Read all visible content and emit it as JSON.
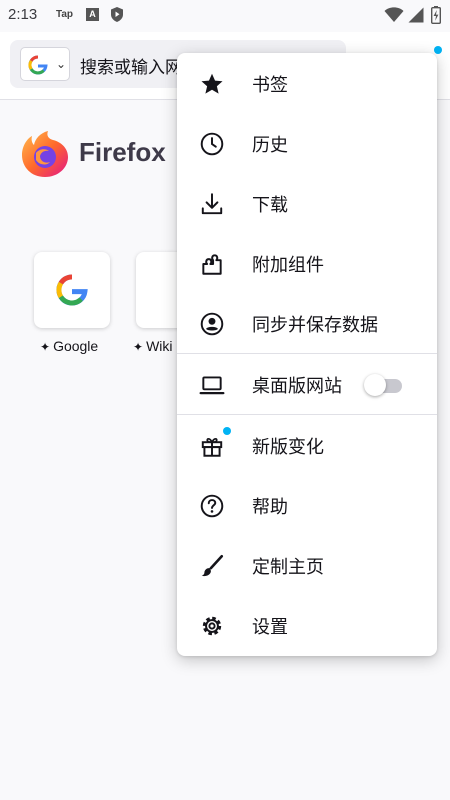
{
  "status_bar": {
    "time": "2:13",
    "tap_label": "Tap",
    "a_label": "A"
  },
  "toolbar": {
    "search_placeholder": "搜索或输入网址",
    "engine_letter": "G"
  },
  "home": {
    "brand_name": "Firefox",
    "shortcuts": [
      {
        "label": "Google"
      },
      {
        "label": "Wiki"
      }
    ]
  },
  "menu": {
    "items": [
      {
        "label": "书签",
        "icon": "star-icon"
      },
      {
        "label": "历史",
        "icon": "clock-icon"
      },
      {
        "label": "下载",
        "icon": "download-icon"
      },
      {
        "label": "附加组件",
        "icon": "puzzle-icon"
      },
      {
        "label": "同步并保存数据",
        "icon": "account-icon"
      },
      {
        "label": "桌面版网站",
        "icon": "laptop-icon",
        "toggle_on": false
      },
      {
        "label": "新版变化",
        "icon": "gift-icon"
      },
      {
        "label": "帮助",
        "icon": "help-icon"
      },
      {
        "label": "定制主页",
        "icon": "brush-icon"
      },
      {
        "label": "设置",
        "icon": "gear-icon"
      }
    ]
  },
  "colors": {
    "accent": "#00b3f4",
    "text": "#15141a"
  }
}
